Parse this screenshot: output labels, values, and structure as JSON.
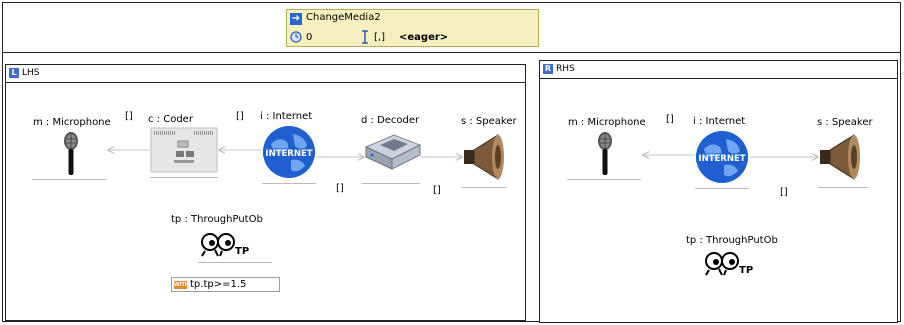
{
  "rule": {
    "name": "ChangeMedia2",
    "priority": "0",
    "multiplicity": "[,]",
    "mode": "<eager>"
  },
  "lhs": {
    "title": "LHS",
    "nodes": {
      "microphone": "m : Microphone",
      "coder": "c : Coder",
      "internet": "i : Internet",
      "decoder": "d : Decoder",
      "speaker": "s : Speaker",
      "throughput": "tp : ThroughPutOb"
    },
    "multiplicities": [
      "[]",
      "[]",
      "[]",
      "[]"
    ],
    "constraint": "tp.tp>=1.5"
  },
  "rhs": {
    "title": "RHS",
    "nodes": {
      "microphone": "m : Microphone",
      "internet": "i : Internet",
      "speaker": "s : Speaker",
      "throughput": "tp : ThroughPutOb"
    },
    "multiplicities": [
      "[]",
      "[]"
    ]
  },
  "icons": {
    "rule": "rule-arrow-icon",
    "priority": "clock-icon",
    "multiplicity": "ibeam-icon",
    "lhs": "lhs-badge-icon",
    "rhs": "rhs-badge-icon",
    "constraint": "with-constraint-icon"
  }
}
